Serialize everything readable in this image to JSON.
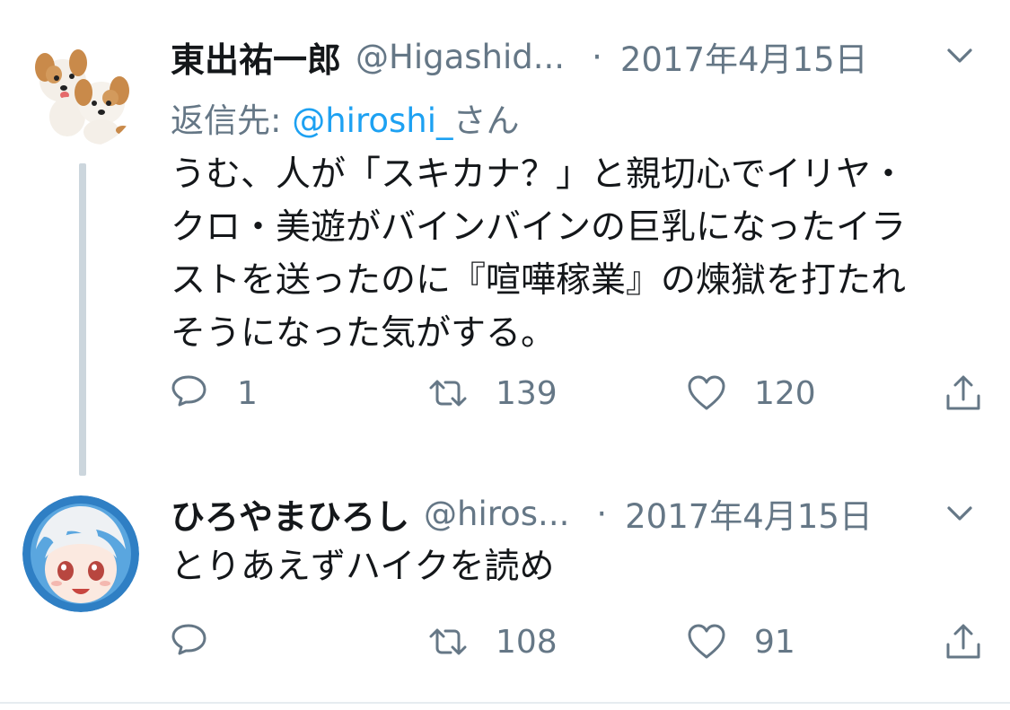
{
  "tweets": [
    {
      "display_name": "東出祐一郎",
      "handle": "@Higashid...",
      "separator": "·",
      "date": "2017年4月15日",
      "reply_to_prefix": "返信先: ",
      "reply_to_mention": "@hiroshi_",
      "reply_to_suffix": "さん",
      "text": "うむ、人が「スキカナ？」と親切心でイリヤ・\nクロ・美遊がバインバインの巨乳になったイラ\nストを送ったのに『喧嘩稼業』の煉獄を打たれ\nそうになった気がする。",
      "reply_count": "1",
      "retweet_count": "139",
      "like_count": "120"
    },
    {
      "display_name": "ひろやまひろし",
      "handle": "@hiros...",
      "separator": "·",
      "date": "2017年4月15日",
      "text": "とりあえずハイクを読め",
      "reply_count": "",
      "retweet_count": "108",
      "like_count": "91"
    }
  ],
  "icons": {
    "reply": "reply-icon",
    "retweet": "retweet-icon",
    "like": "heart-icon",
    "share": "share-icon",
    "menu": "chevron-down-icon"
  },
  "colors": {
    "text": "#14171a",
    "secondary": "#657786",
    "mention": "#1da1f2",
    "thread_line": "#ccd6dd"
  }
}
